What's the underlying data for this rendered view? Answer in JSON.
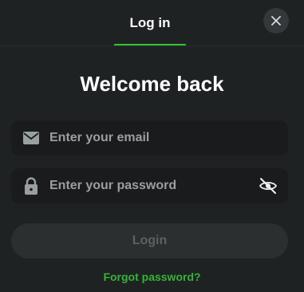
{
  "header": {
    "tab_label": "Log in",
    "close_icon": "close-icon"
  },
  "main": {
    "title": "Welcome back",
    "email": {
      "icon": "envelope-icon",
      "placeholder": "Enter your email",
      "value": ""
    },
    "password": {
      "icon": "lock-icon",
      "placeholder": "Enter your password",
      "value": "",
      "toggle_icon": "eye-off-icon"
    },
    "login_label": "Login",
    "forgot_label": "Forgot password?"
  },
  "colors": {
    "background": "#1f2223",
    "field_background": "#191b1c",
    "accent": "#33c233",
    "button_disabled": "#2b2f30"
  }
}
